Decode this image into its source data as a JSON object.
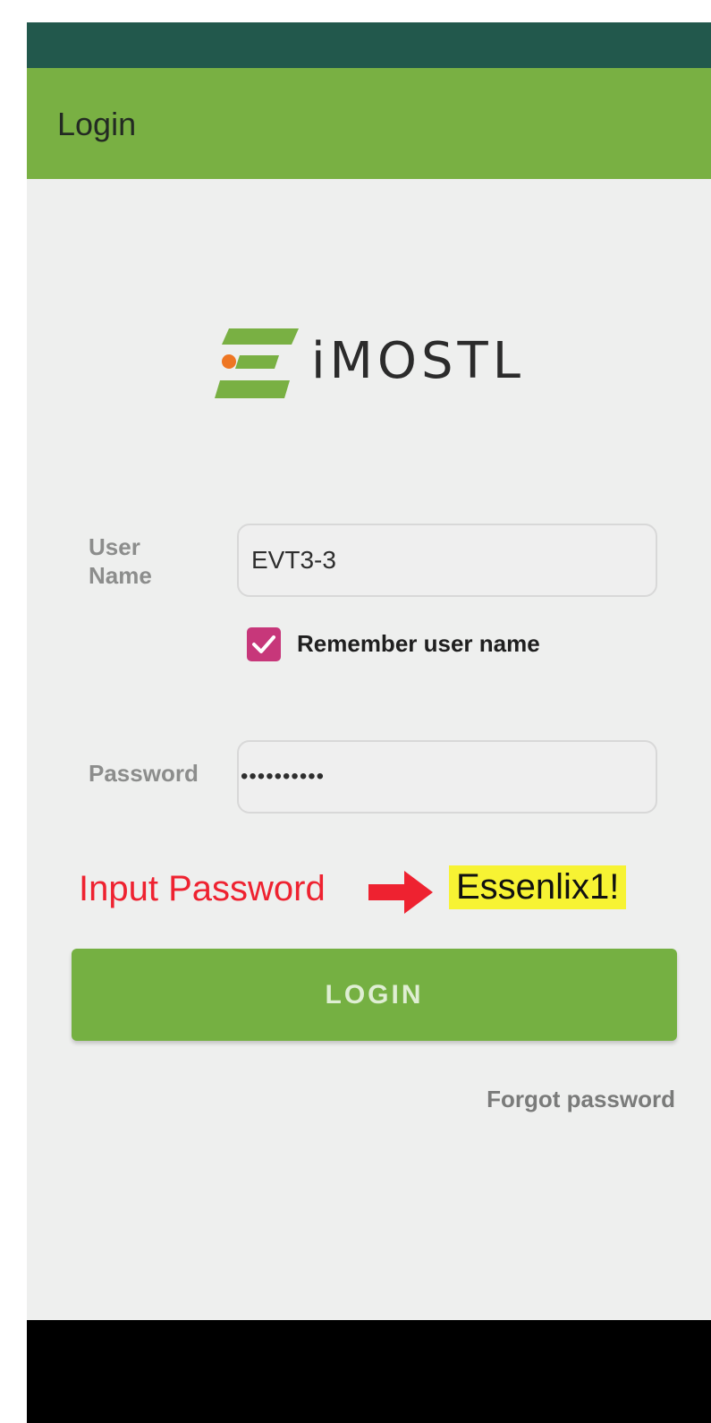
{
  "app_bar": {
    "title": "Login"
  },
  "logo": {
    "text": "iMOSTL",
    "icon": "e-stripes-logo-icon"
  },
  "username": {
    "label": "User\nName",
    "value": "EVT3-3"
  },
  "remember": {
    "label": "Remember user name",
    "checked": true
  },
  "password": {
    "label": "Password",
    "masked_value": "••••••••••"
  },
  "annotation": {
    "text": "Input Password",
    "arrow_icon": "red-arrow-right-icon",
    "password_value": "Essenlix1!"
  },
  "login_button": {
    "label": "LOGIN"
  },
  "forgot_password": {
    "label": "Forgot password"
  },
  "colors": {
    "status_bar": "#22584c",
    "app_bar": "#79b043",
    "accent_green": "#75b042",
    "checkbox": "#c7377a",
    "annotation_red": "#ee2230",
    "highlight_yellow": "#f7f333"
  }
}
